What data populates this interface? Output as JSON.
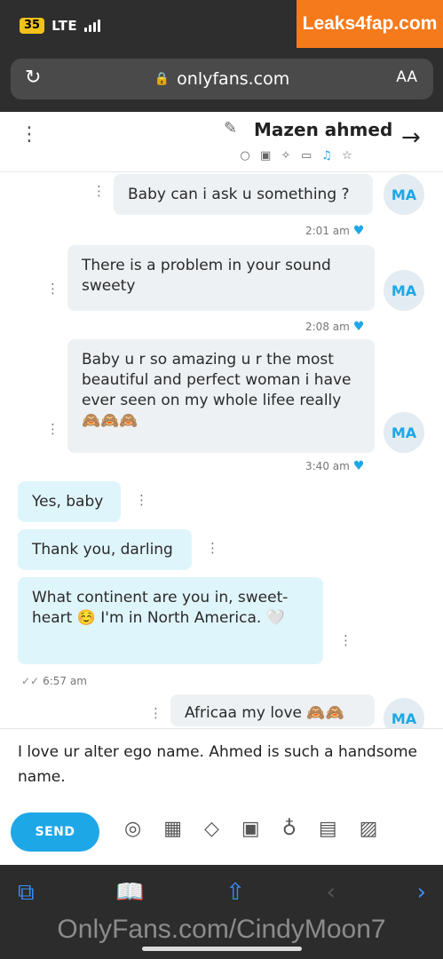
{
  "status": {
    "battery": "35",
    "network": "LTE"
  },
  "watermark": "Leaks4fap.com",
  "browser": {
    "url": "onlyfans.com",
    "text_size": "AA"
  },
  "chat": {
    "contact_name": "Mazen ahmed",
    "avatar_initials": "MA"
  },
  "messages": [
    {
      "text": "Baby can i ask u something ?"
    },
    {
      "text": "There is a problem in your sound sweety"
    },
    {
      "text": "Baby u r so amazing u r the most beautiful and perfect woman i have ever seen on my whole lifee really 🙈🙈🙈"
    },
    {
      "text": "Yes, baby"
    },
    {
      "text": "Thank you, darling"
    },
    {
      "text": "What continent are you in, sweet-heart ☺️ I'm in North America. 🤍"
    },
    {
      "text": "Africaa my love 🙈🙈"
    }
  ],
  "timestamps": [
    "2:01 am",
    "2:08 am",
    "3:40 am",
    "6:57 am"
  ],
  "composer": {
    "draft": "I love ur alter ego name.  Ahmed is such a handsome name.",
    "send_label": "SEND"
  },
  "footer_watermark": "OnlyFans.com/CindyMoon7"
}
